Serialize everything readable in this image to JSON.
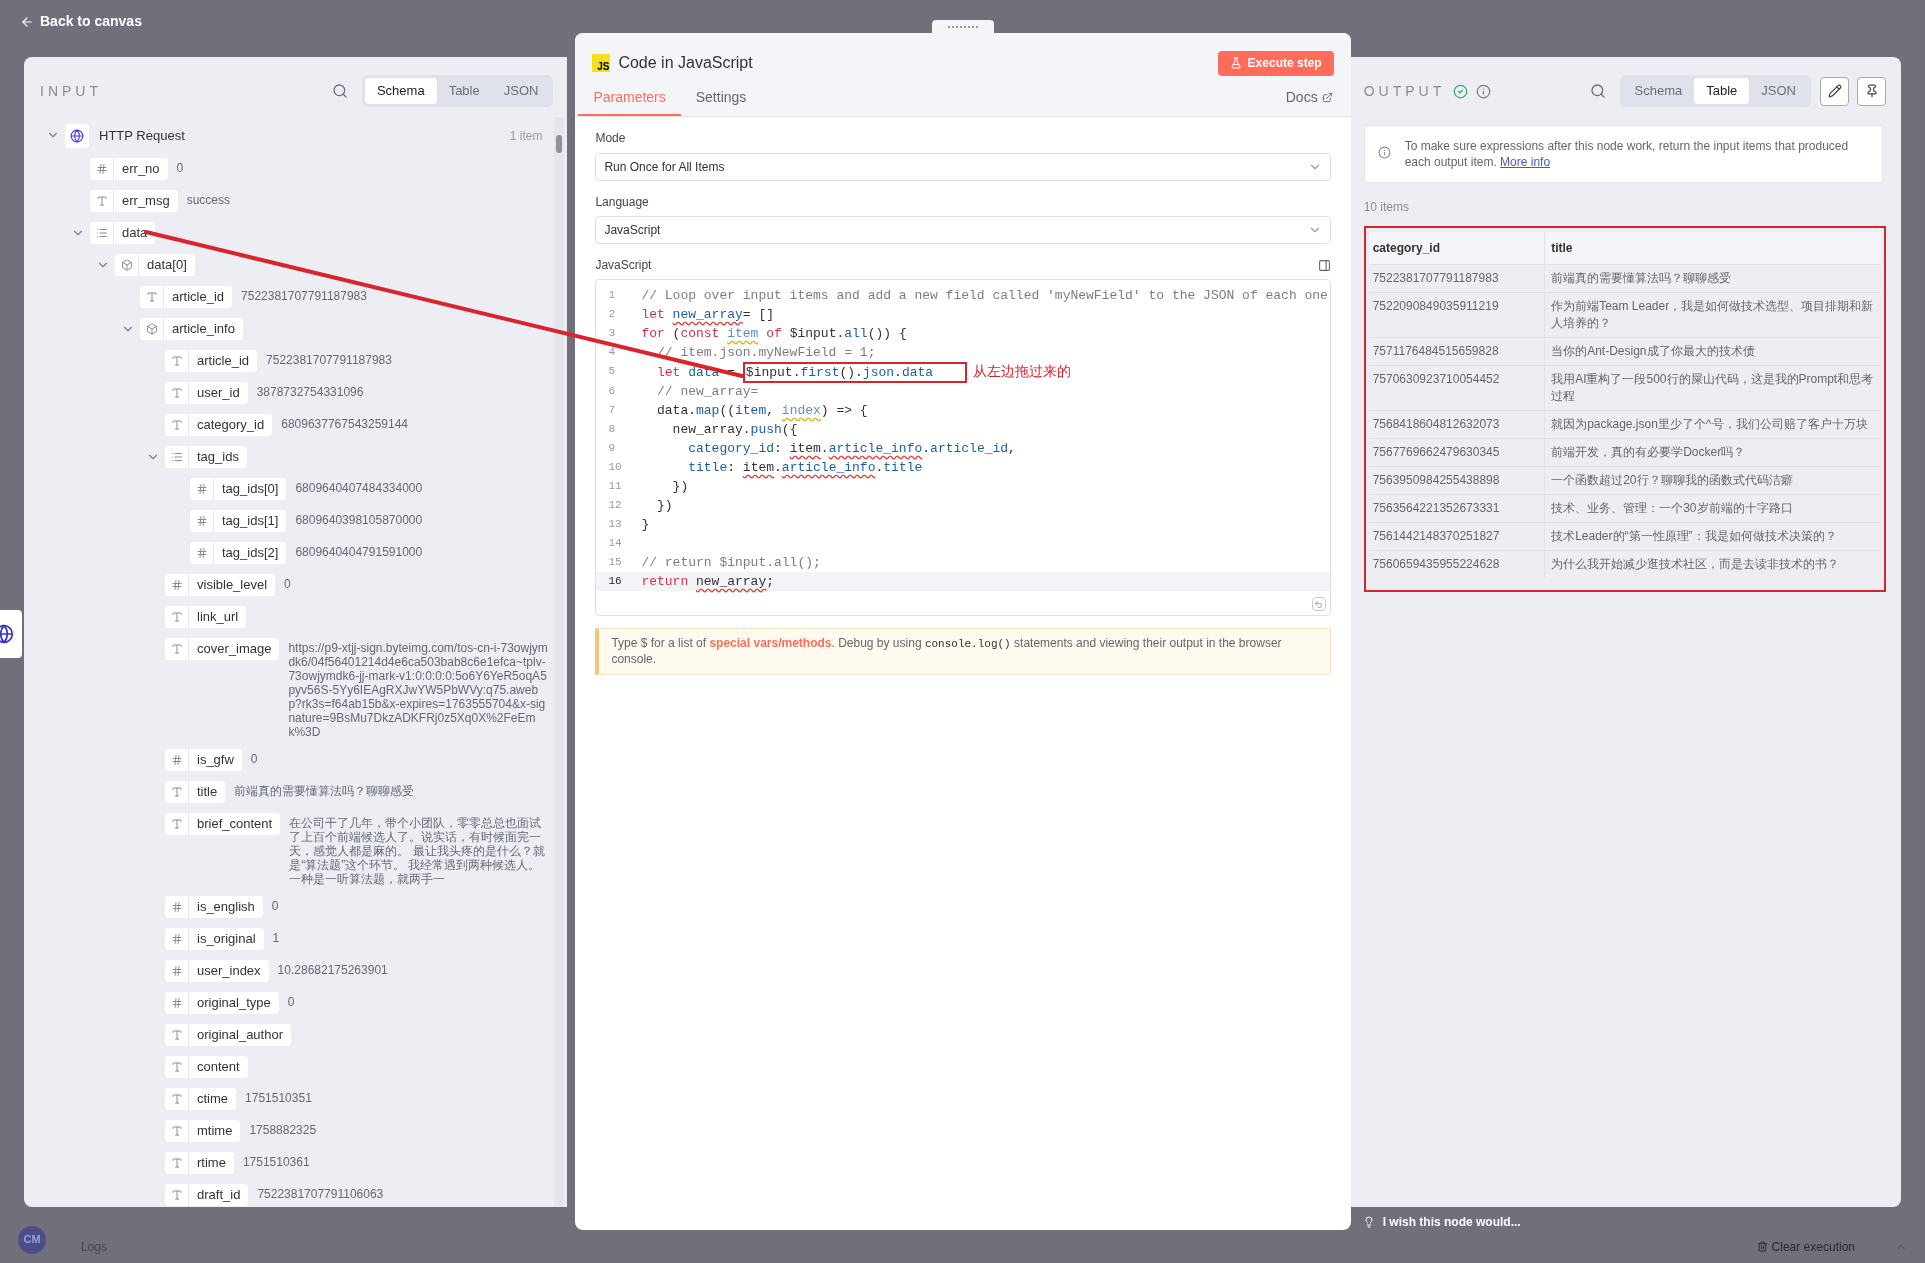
{
  "header": {
    "back_label": "Back to canvas"
  },
  "input": {
    "title": "INPUT",
    "views": [
      {
        "label": "Schema",
        "selected": true
      },
      {
        "label": "Table",
        "selected": false
      },
      {
        "label": "JSON",
        "selected": false
      }
    ],
    "tree": {
      "kind": "root",
      "key": "HTTP Request",
      "count": "1 item",
      "expanded": true,
      "children": [
        {
          "kind": "number",
          "key": "err_no",
          "value": "0"
        },
        {
          "kind": "string",
          "key": "err_msg",
          "value": "success"
        },
        {
          "kind": "array",
          "key": "data",
          "expanded": true,
          "children": [
            {
              "kind": "object",
              "key": "data[0]",
              "expanded": true,
              "children": [
                {
                  "kind": "string",
                  "key": "article_id",
                  "value": "7522381707791187983"
                },
                {
                  "kind": "object",
                  "key": "article_info",
                  "expanded": true,
                  "children": [
                    {
                      "kind": "string",
                      "key": "article_id",
                      "value": "7522381707791187983"
                    },
                    {
                      "kind": "string",
                      "key": "user_id",
                      "value": "3878732754331096"
                    },
                    {
                      "kind": "string",
                      "key": "category_id",
                      "value": "6809637767543259144"
                    },
                    {
                      "kind": "array",
                      "key": "tag_ids",
                      "expanded": true,
                      "children": [
                        {
                          "kind": "number",
                          "key": "tag_ids[0]",
                          "value": "6809640407484334000"
                        },
                        {
                          "kind": "number",
                          "key": "tag_ids[1]",
                          "value": "6809640398105870000"
                        },
                        {
                          "kind": "number",
                          "key": "tag_ids[2]",
                          "value": "6809640404791591000"
                        }
                      ]
                    },
                    {
                      "kind": "number",
                      "key": "visible_level",
                      "value": "0"
                    },
                    {
                      "kind": "string",
                      "key": "link_url"
                    },
                    {
                      "kind": "string",
                      "key": "cover_image",
                      "value": "https://p9-xtjj-sign.byteimg.com/tos-cn-i-73owjymdk6/04f56401214d4e6ca503bab8c6e1efca~tplv-73owjymdk6-jj-mark-v1:0:0:0:0:5o6Y6YeR5oqA5pyv56S-5Yy6IEAgRXJwYW5PbWVy:q75.awebp?rk3s=f64ab15b&x-expires=1763555704&x-signature=9BsMu7DkzADKFRj0z5Xq0X%2FeEmk%3D"
                    },
                    {
                      "kind": "number",
                      "key": "is_gfw",
                      "value": "0"
                    },
                    {
                      "kind": "string",
                      "key": "title",
                      "value": "前端真的需要懂算法吗？聊聊感受"
                    },
                    {
                      "kind": "string",
                      "key": "brief_content",
                      "value": "在公司干了几年，带个小团队，零零总总也面试了上百个前端候选人了。说实话，有时候面完一天，感觉人都是麻的。 最让我头疼的是什么？就是“算法题”这个环节。 我经常遇到两种候选人。一种是一听算法题，就两手一"
                    },
                    {
                      "kind": "number",
                      "key": "is_english",
                      "value": "0"
                    },
                    {
                      "kind": "number",
                      "key": "is_original",
                      "value": "1"
                    },
                    {
                      "kind": "number",
                      "key": "user_index",
                      "value": "10.28682175263901"
                    },
                    {
                      "kind": "number",
                      "key": "original_type",
                      "value": "0"
                    },
                    {
                      "kind": "string",
                      "key": "original_author"
                    },
                    {
                      "kind": "string",
                      "key": "content"
                    },
                    {
                      "kind": "string",
                      "key": "ctime",
                      "value": "1751510351"
                    },
                    {
                      "kind": "string",
                      "key": "mtime",
                      "value": "1758882325"
                    },
                    {
                      "kind": "string",
                      "key": "rtime",
                      "value": "1751510361"
                    },
                    {
                      "kind": "string",
                      "key": "draft_id",
                      "value": "7522381707791106063"
                    }
                  ]
                }
              ]
            }
          ]
        }
      ]
    }
  },
  "node": {
    "badge": "JS",
    "title": "Code in JavaScript",
    "execute_label": "Execute step",
    "tabs": [
      {
        "label": "Parameters",
        "selected": true
      },
      {
        "label": "Settings",
        "selected": false
      }
    ],
    "docs_label": "Docs",
    "mode": {
      "label": "Mode",
      "value": "Run Once for All Items"
    },
    "language": {
      "label": "Language",
      "value": "JavaScript"
    },
    "code_label": "JavaScript",
    "code": [
      {
        "n": "1",
        "active": false,
        "tokens": [
          {
            "kind": "comment",
            "text": "// Loop over input items and add a new field called 'myNewField' to the JSON of each one"
          }
        ]
      },
      {
        "n": "2",
        "active": false,
        "tokens": [
          {
            "kind": "keyword",
            "text": "let "
          },
          {
            "kind": "error",
            "text": "new_array"
          },
          {
            "kind": "text",
            "text": "= []"
          }
        ]
      },
      {
        "n": "3",
        "active": false,
        "tokens": [
          {
            "kind": "keyword",
            "text": "for"
          },
          {
            "kind": "text",
            "text": " ("
          },
          {
            "kind": "keyword",
            "text": "const "
          },
          {
            "kind": "warning",
            "text": "item"
          },
          {
            "kind": "keyword",
            "text": " of"
          },
          {
            "kind": "text",
            "text": " $input."
          },
          {
            "kind": "name",
            "text": "all"
          },
          {
            "kind": "text",
            "text": "()) {"
          }
        ]
      },
      {
        "n": "4",
        "active": false,
        "tokens": [
          {
            "kind": "comment",
            "text": "  // item.json.myNewField = 1;"
          }
        ]
      },
      {
        "n": "5",
        "active": false,
        "tokens": [
          {
            "kind": "keyword",
            "text": "  let "
          },
          {
            "kind": "name",
            "text": "data"
          },
          {
            "kind": "text",
            "text": " = "
          },
          {
            "kind": "mark",
            "note": "从左边拖过来的",
            "tokens": [
              {
                "kind": "text",
                "text": "$input."
              },
              {
                "kind": "name",
                "text": "first"
              },
              {
                "kind": "text",
                "text": "()."
              },
              {
                "kind": "name",
                "text": "json"
              },
              {
                "kind": "text",
                "text": "."
              },
              {
                "kind": "name",
                "text": "data"
              }
            ]
          }
        ]
      },
      {
        "n": "6",
        "active": false,
        "tokens": [
          {
            "kind": "comment",
            "text": "  // new_array="
          }
        ]
      },
      {
        "n": "7",
        "active": false,
        "tokens": [
          {
            "kind": "text",
            "text": "  data."
          },
          {
            "kind": "name",
            "text": "map"
          },
          {
            "kind": "text",
            "text": "(("
          },
          {
            "kind": "name",
            "text": "item"
          },
          {
            "kind": "text",
            "text": ", "
          },
          {
            "kind": "warning",
            "text": "index"
          },
          {
            "kind": "text",
            "text": ") => {"
          }
        ]
      },
      {
        "n": "8",
        "active": false,
        "tokens": [
          {
            "kind": "text",
            "text": "    new_array."
          },
          {
            "kind": "name",
            "text": "push"
          },
          {
            "kind": "text",
            "text": "({"
          }
        ]
      },
      {
        "n": "9",
        "active": false,
        "tokens": [
          {
            "kind": "name",
            "text": "      category_id"
          },
          {
            "kind": "text",
            "text": ": "
          },
          {
            "kind": "errortext",
            "text": "item"
          },
          {
            "kind": "text",
            "text": "."
          },
          {
            "kind": "error",
            "text": "article_info"
          },
          {
            "kind": "text",
            "text": "."
          },
          {
            "kind": "name",
            "text": "article_id"
          },
          {
            "kind": "text",
            "text": ","
          }
        ]
      },
      {
        "n": "10",
        "active": false,
        "tokens": [
          {
            "kind": "name",
            "text": "      title"
          },
          {
            "kind": "text",
            "text": ": "
          },
          {
            "kind": "errortext",
            "text": "item"
          },
          {
            "kind": "text",
            "text": "."
          },
          {
            "kind": "error",
            "text": "article_info"
          },
          {
            "kind": "text",
            "text": "."
          },
          {
            "kind": "name",
            "text": "title"
          }
        ]
      },
      {
        "n": "11",
        "active": false,
        "tokens": [
          {
            "kind": "text",
            "text": "    })"
          }
        ]
      },
      {
        "n": "12",
        "active": false,
        "tokens": [
          {
            "kind": "text",
            "text": "  })"
          }
        ]
      },
      {
        "n": "13",
        "active": false,
        "tokens": [
          {
            "kind": "text",
            "text": "}"
          }
        ]
      },
      {
        "n": "14",
        "active": false
      },
      {
        "n": "15",
        "active": false,
        "tokens": [
          {
            "kind": "comment",
            "text": "// return $input.all();"
          }
        ]
      },
      {
        "n": "16",
        "active": true,
        "tokens": [
          {
            "kind": "keyword",
            "text": "return "
          },
          {
            "kind": "errortext",
            "text": "new_array"
          },
          {
            "kind": "text",
            "text": ";"
          }
        ]
      }
    ],
    "hint": [
      {
        "kind": "text",
        "text": "Type $ for a list of "
      },
      {
        "kind": "link",
        "text": "special vars/methods"
      },
      {
        "kind": "text",
        "text": ". Debug by using "
      },
      {
        "kind": "code",
        "text": "console.log()"
      },
      {
        "kind": "text",
        "text": " statements and viewing their output in the browser console."
      }
    ]
  },
  "output": {
    "title": "OUTPUT",
    "views": [
      {
        "label": "Schema",
        "selected": false
      },
      {
        "label": "Table",
        "selected": true
      },
      {
        "label": "JSON",
        "selected": false
      }
    ],
    "notice": {
      "text": "To make sure expressions after this node work, return the input items that produced each output item.",
      "link": "More info"
    },
    "count": "10 items",
    "table": {
      "annotated": true,
      "columns": [
        "category_id",
        "title"
      ],
      "rows": [
        [
          "7522381707791187983",
          "前端真的需要懂算法吗？聊聊感受"
        ],
        [
          "7522090849035911219",
          "作为前端Team Leader，我是如何做技术选型、项目排期和新人培养的？"
        ],
        [
          "7571176484515659828",
          "当你的Ant-Design成了你最大的技术债"
        ],
        [
          "7570630923710054452",
          "我用AI重构了一段500行的屎山代码，这是我的Prompt和思考过程"
        ],
        [
          "7568418604812632073",
          "就因为package.json里少了个^号，我们公司赔了客户十万块"
        ],
        [
          "7567769662479630345",
          "前端开发，真的有必要学Docker吗？"
        ],
        [
          "7563950984255438898",
          "一个函数超过20行？聊聊我的函数式代码洁癖"
        ],
        [
          "7563564221352673331",
          "技术、业务、管理：一个30岁前端的十字路口"
        ],
        [
          "7561442148370251827",
          "技术Leader的“第一性原理”：我是如何做技术决策的？"
        ],
        [
          "7560659435955224628",
          "为什么我开始减少逛技术社区，而是去读非技术的书？"
        ]
      ]
    },
    "feedback": "I wish this node would..."
  },
  "footer": {
    "avatar": "CM",
    "logs_label": "Logs",
    "clear_label": "Clear execution"
  }
}
